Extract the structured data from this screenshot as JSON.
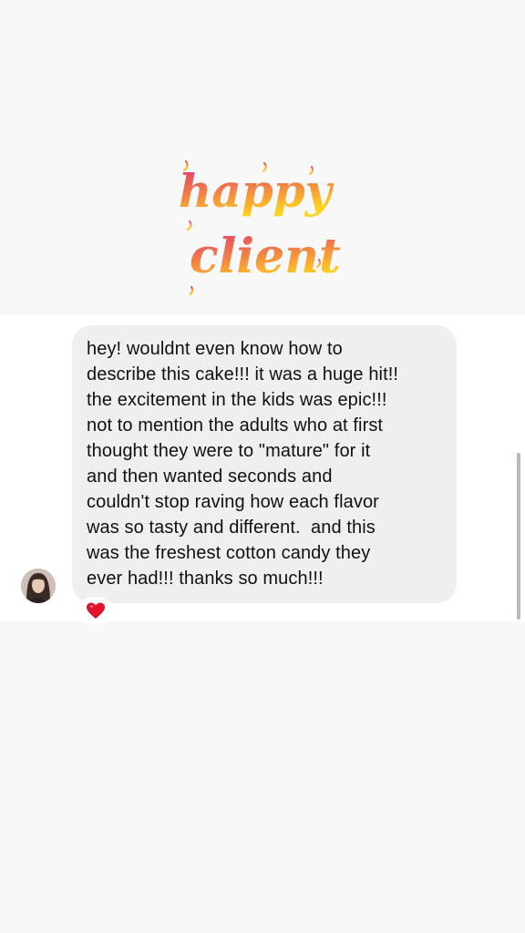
{
  "header_graphic": {
    "logo_text_line1": "happy",
    "logo_text_line2": "client",
    "icon": "happy-client-lettering",
    "gradient_colors": [
      "#e2366f",
      "#f07a4a",
      "#ffd21e"
    ]
  },
  "message": {
    "lines": [
      "hey! wouldnt even know how to",
      "describe this cake!!! it was a huge hit!!",
      "the excitement in the kids was epic!!!",
      "not to mention the adults who at first",
      "thought they were to \"mature\" for it",
      "and then wanted seconds and",
      "couldn't stop raving how each flavor",
      "was so tasty and different.  and this",
      "was the freshest cotton candy they",
      "ever had!!! thanks so much!!!"
    ],
    "bubble_color": "#efefef",
    "reaction": {
      "icon": "red-heart-icon",
      "color": "#e0142b"
    }
  },
  "sender": {
    "avatar_icon": "sender-avatar"
  }
}
